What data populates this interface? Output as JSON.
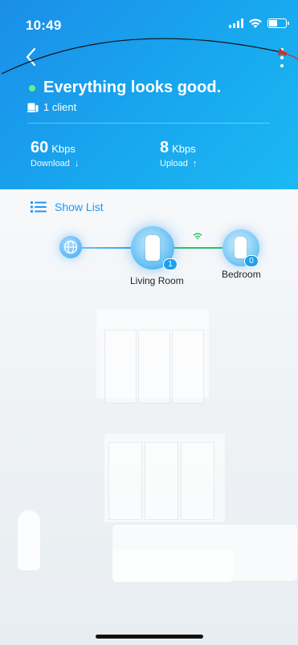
{
  "status_bar": {
    "time": "10:49"
  },
  "header": {
    "status_text": "Everything looks good.",
    "client_count": "1 client",
    "download": {
      "value": "60",
      "unit": "Kbps",
      "label": "Download",
      "arrow": "↓"
    },
    "upload": {
      "value": "8",
      "unit": "Kbps",
      "label": "Upload",
      "arrow": "↑"
    }
  },
  "show_list_label": "Show List",
  "topology": {
    "main_node": {
      "name": "Living Room",
      "clients": "1"
    },
    "satellite_node": {
      "name": "Bedroom",
      "clients": "0"
    }
  },
  "colors": {
    "header_start": "#1b8ee8",
    "header_end": "#1bb9f2",
    "status_ok": "#5df58a",
    "accent": "#2196f3",
    "wireless_link": "#22c55e",
    "annotation_arrow": "#c0392b"
  }
}
